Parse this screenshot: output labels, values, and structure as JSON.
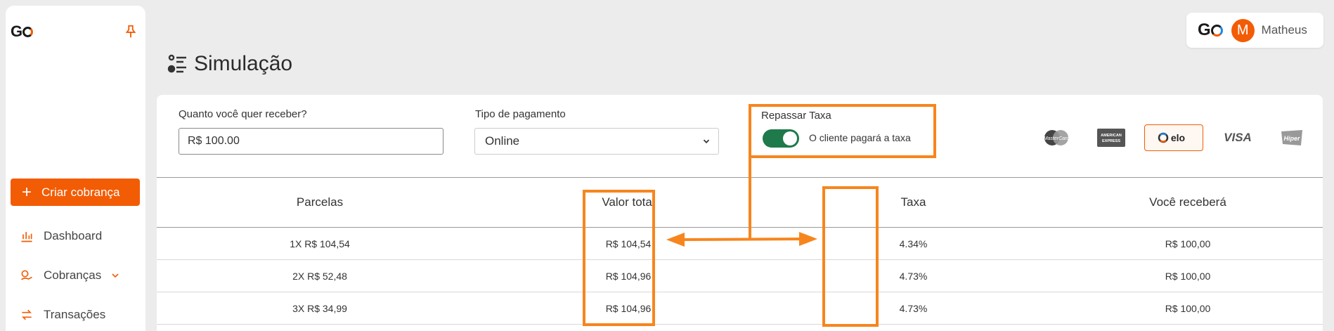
{
  "sidebar": {
    "logo": "G",
    "create_button": "Criar cobrança",
    "items": [
      {
        "label": "Dashboard",
        "icon": "bar-chart-icon"
      },
      {
        "label": "Cobranças",
        "icon": "billing-icon"
      },
      {
        "label": "Transações",
        "icon": "transfer-icon"
      }
    ]
  },
  "header": {
    "title": "Simulação",
    "user_logo": "G",
    "avatar_initial": "M",
    "user_name": "Matheus"
  },
  "form": {
    "amount_label": "Quanto você quer receber?",
    "amount_value": "R$ 100.00",
    "payment_label": "Tipo de pagamento",
    "payment_value": "Online",
    "fee_label": "Repassar Taxa",
    "fee_toggle_label": "O cliente pagará a taxa",
    "fee_toggle_on": true
  },
  "brands": {
    "mastercard": "MasterCard",
    "amex_line1": "AMERICAN",
    "amex_line2": "EXPRESS",
    "elo": "elo",
    "visa": "VISA",
    "hiper": "Hiper"
  },
  "table": {
    "headers": [
      "Parcelas",
      "Valor total",
      "Taxa",
      "Você receberá"
    ],
    "rows": [
      [
        "1X R$ 104,54",
        "R$ 104,54",
        "4.34%",
        "R$ 100,00"
      ],
      [
        "2X R$ 52,48",
        "R$ 104,96",
        "4.73%",
        "R$ 100,00"
      ],
      [
        "3X R$ 34,99",
        "R$ 104,96",
        "4.73%",
        "R$ 100,00"
      ]
    ]
  },
  "colors": {
    "accent": "#f25c05",
    "annotation": "#f7851e",
    "toggle_on": "#1e7a4a"
  }
}
